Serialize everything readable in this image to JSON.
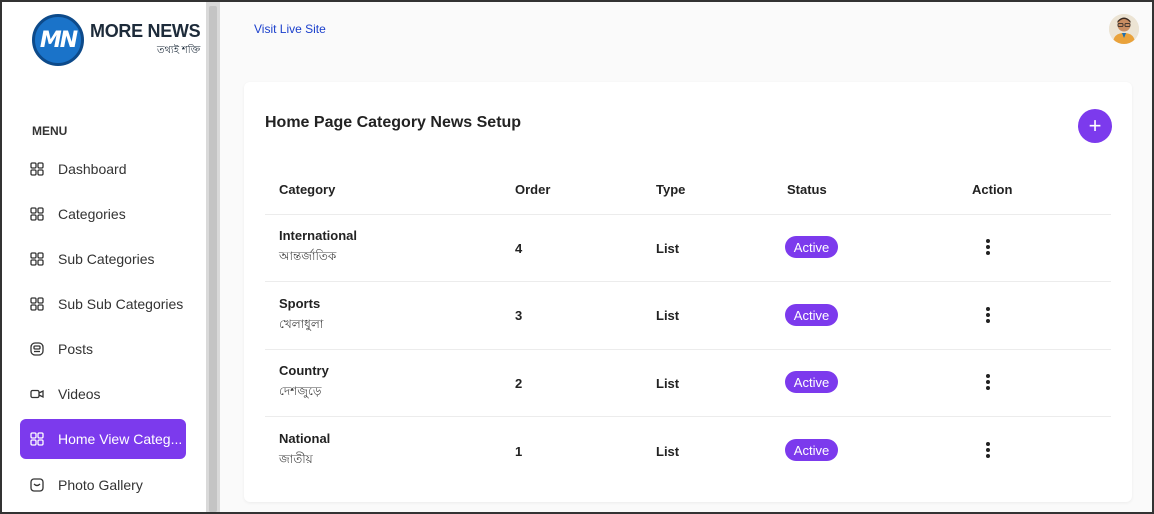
{
  "app": {
    "logo_text": "MN",
    "brand_name": "MORE NEWS",
    "brand_tagline": "তথ্যই শক্তি"
  },
  "sidebar": {
    "menu_heading": "MENU",
    "items": [
      {
        "label": "Dashboard",
        "icon": "grid-icon",
        "active": false
      },
      {
        "label": "Categories",
        "icon": "grid-icon",
        "active": false
      },
      {
        "label": "Sub Categories",
        "icon": "grid-icon",
        "active": false
      },
      {
        "label": "Sub Sub Categories",
        "icon": "grid-icon",
        "active": false
      },
      {
        "label": "Posts",
        "icon": "posts-icon",
        "active": false
      },
      {
        "label": "Videos",
        "icon": "video-icon",
        "active": false
      },
      {
        "label": "Home View Categ...",
        "icon": "grid-icon",
        "active": true
      },
      {
        "label": "Photo Gallery",
        "icon": "gallery-icon",
        "active": false
      }
    ]
  },
  "topbar": {
    "visit_link": "Visit Live Site",
    "avatar": "user-avatar"
  },
  "card": {
    "title": "Home Page Category News Setup",
    "add_button": "+",
    "columns": [
      "Category",
      "Order",
      "Type",
      "Status",
      "Action"
    ],
    "rows": [
      {
        "category": "International",
        "category_bn": "আন্তর্জাতিক",
        "order": "4",
        "type": "List",
        "status": "Active"
      },
      {
        "category": "Sports",
        "category_bn": "খেলাধুলা",
        "order": "3",
        "type": "List",
        "status": "Active"
      },
      {
        "category": "Country",
        "category_bn": "দেশজুড়ে",
        "order": "2",
        "type": "List",
        "status": "Active"
      },
      {
        "category": "National",
        "category_bn": "জাতীয়",
        "order": "1",
        "type": "List",
        "status": "Active"
      }
    ]
  },
  "colors": {
    "accent": "#7c3aed",
    "link": "#1a3fcc",
    "logo_blue": "#1a73c9"
  }
}
